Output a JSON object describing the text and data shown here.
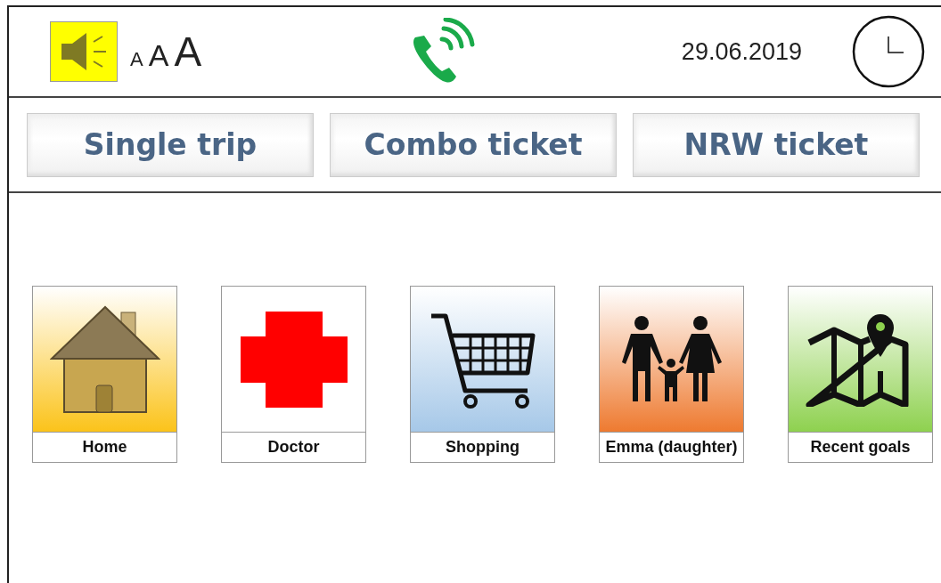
{
  "header": {
    "font_sizes": [
      "A",
      "A",
      "A"
    ],
    "date": "29.06.2019"
  },
  "tabs": [
    {
      "label": "Single trip"
    },
    {
      "label": "Combo ticket"
    },
    {
      "label": "NRW ticket"
    }
  ],
  "tiles": [
    {
      "kind": "home",
      "label": "Home",
      "color": "#fbc31a"
    },
    {
      "kind": "doctor",
      "label": "Doctor",
      "color": "#ffffff"
    },
    {
      "kind": "shopping",
      "label": "Shopping",
      "color": "#a6c8e8"
    },
    {
      "kind": "family",
      "label": "Emma (daughter)",
      "color": "#ee7a30"
    },
    {
      "kind": "map",
      "label": "Recent goals",
      "color": "#8ed14f"
    }
  ]
}
